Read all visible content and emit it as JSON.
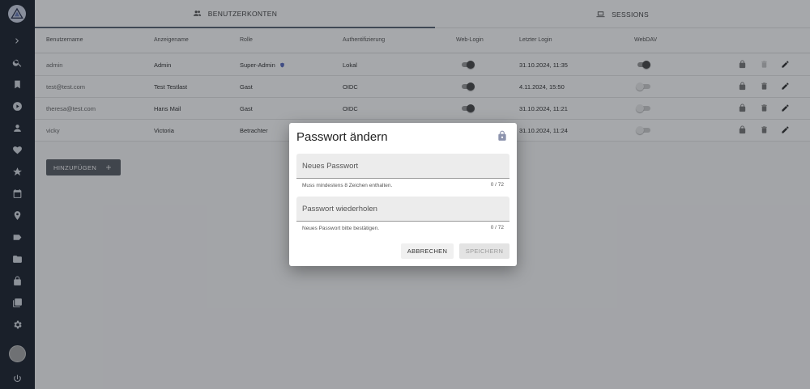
{
  "tabs": [
    {
      "label": "BENUTZERKONTEN",
      "icon": "people-icon",
      "active": true
    },
    {
      "label": "SESSIONS",
      "icon": "laptop-icon",
      "active": false
    }
  ],
  "table": {
    "headers": [
      "Benutzername",
      "Anzeigename",
      "Rolle",
      "Authentifizierung",
      "Web-Login",
      "Letzter Login",
      "WebDAV"
    ],
    "rows": [
      {
        "username": "admin",
        "display": "Admin",
        "role": "Super-Admin",
        "auth": "Lokal",
        "web_login": true,
        "last_login": "31.10.2024, 11:35",
        "webdav": true
      },
      {
        "username": "test@test.com",
        "display": "Test Testlast",
        "role": "Gast",
        "auth": "OIDC",
        "web_login": true,
        "last_login": "4.11.2024, 15:50",
        "webdav": false
      },
      {
        "username": "theresa@test.com",
        "display": "Hans Mail",
        "role": "Gast",
        "auth": "OIDC",
        "web_login": true,
        "last_login": "31.10.2024, 11:21",
        "webdav": false
      },
      {
        "username": "vicky",
        "display": "Victoria",
        "role": "Betrachter",
        "auth": "",
        "web_login": false,
        "last_login": "31.10.2024, 11:24",
        "webdav": false
      }
    ]
  },
  "add_button": "HINZUFÜGEN",
  "dialog": {
    "title": "Passwort ändern",
    "new_password_placeholder": "Neues Passwort",
    "new_password_hint": "Muss mindestens 8 Zeichen enthalten.",
    "new_password_counter": "0 / 72",
    "repeat_password_placeholder": "Passwort wiederholen",
    "repeat_password_hint": "Neues Passwort bitte bestätigen.",
    "repeat_password_counter": "0 / 72",
    "cancel_label": "ABBRECHEN",
    "save_label": "SPEICHERN"
  },
  "sidebar_icons": [
    "expand-icon",
    "search-icon",
    "bookmark-icon",
    "play-icon",
    "person-icon",
    "heart-icon",
    "star-icon",
    "calendar-icon",
    "location-icon",
    "label-icon",
    "folder-icon",
    "lock-icon",
    "library-icon",
    "settings-icon",
    "power-icon"
  ],
  "colors": {
    "sidebar": "#1e2430",
    "accent": "#5b6cc0"
  }
}
